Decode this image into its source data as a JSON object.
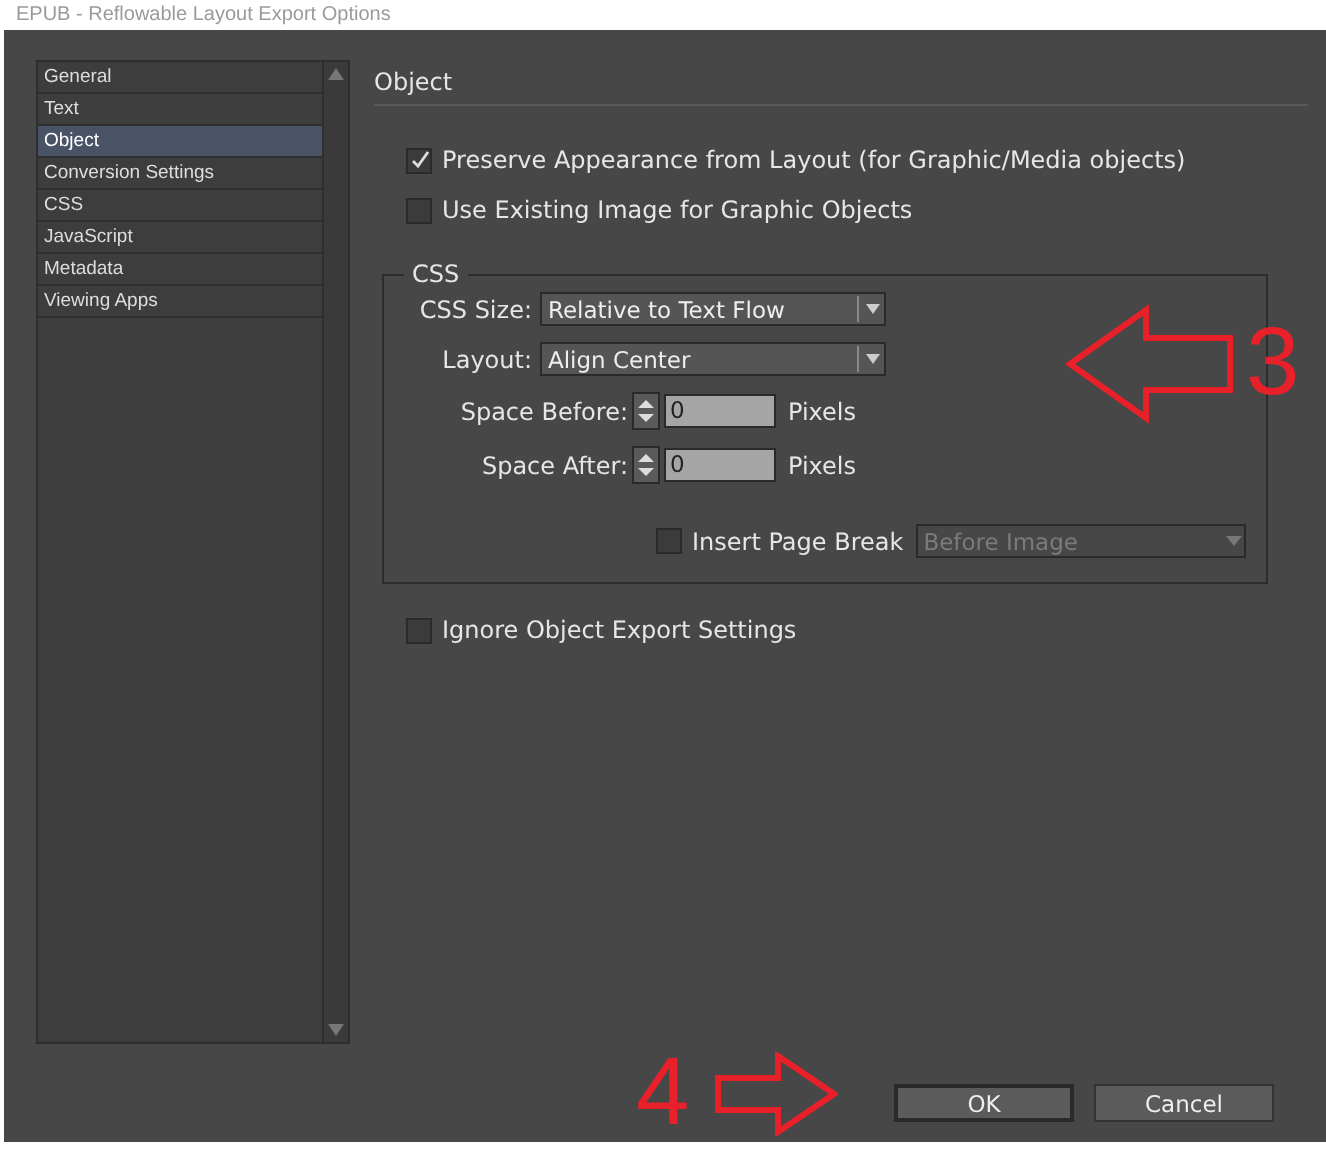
{
  "window": {
    "title": "EPUB - Reflowable Layout Export Options"
  },
  "sidebar": {
    "items": [
      {
        "label": "General",
        "selected": false
      },
      {
        "label": "Text",
        "selected": false
      },
      {
        "label": "Object",
        "selected": true
      },
      {
        "label": "Conversion Settings",
        "selected": false
      },
      {
        "label": "CSS",
        "selected": false
      },
      {
        "label": "JavaScript",
        "selected": false
      },
      {
        "label": "Metadata",
        "selected": false
      },
      {
        "label": "Viewing Apps",
        "selected": false
      }
    ]
  },
  "panel": {
    "heading": "Object",
    "options": [
      {
        "label": "Preserve Appearance from Layout (for Graphic/Media objects)",
        "checked": true
      },
      {
        "label": "Use Existing Image for Graphic Objects",
        "checked": false
      }
    ],
    "css_group": {
      "legend": "CSS",
      "selects": [
        {
          "label": "CSS Size:",
          "value": "Relative to Text Flow"
        },
        {
          "label": "Layout:",
          "value": "Align Center"
        }
      ],
      "spinners": [
        {
          "label": "Space Before:",
          "value": "0",
          "unit": "Pixels"
        },
        {
          "label": "Space After:",
          "value": "0",
          "unit": "Pixels"
        }
      ],
      "page_break": {
        "label": "Insert Page Break",
        "checked": false,
        "value": "Before Image",
        "disabled": true
      }
    },
    "ignore_option": {
      "label": "Ignore Object Export Settings",
      "checked": false
    }
  },
  "annotations": [
    {
      "text": "3"
    },
    {
      "text": "4"
    }
  ],
  "buttons": [
    {
      "label": "OK",
      "focused": true
    },
    {
      "label": "Cancel",
      "focused": false
    }
  ]
}
